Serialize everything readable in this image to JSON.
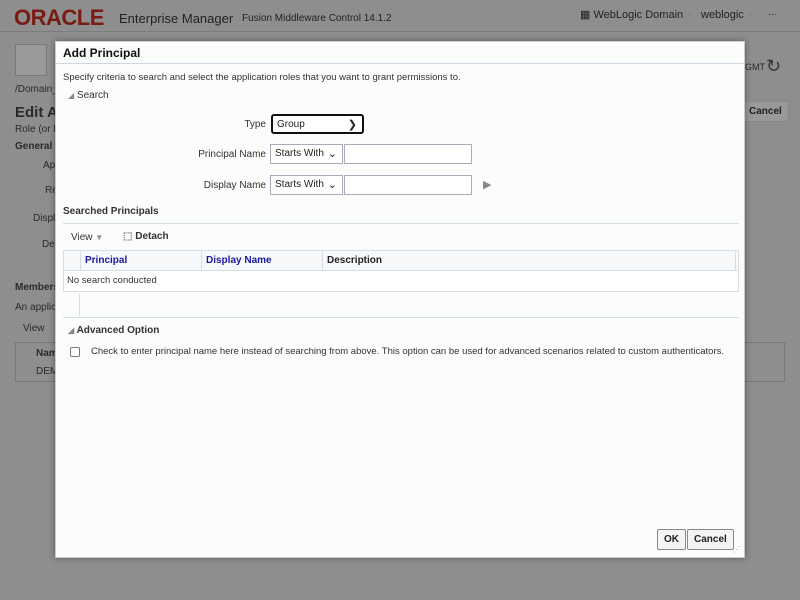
{
  "header": {
    "logo": "ORACLE",
    "product": "Enterprise Manager",
    "subtitle": "Fusion Middleware Control 14.1.2",
    "domain_menu": "WebLogic Domain",
    "user_menu": "weblogic",
    "more": "..."
  },
  "background": {
    "breadcrumb": "/Domain_",
    "title": "Edit A",
    "role": "Role (or E",
    "general": "General",
    "f1": "Ap",
    "f2": "Re",
    "f3": "Displ",
    "f4": "De",
    "members": "Members",
    "applic": "An applic",
    "view": "View",
    "col": "Nam",
    "row": "DEM",
    "gmt": "GMT",
    "cancel": "Cancel"
  },
  "dialog": {
    "title": "Add Principal",
    "instructions": "Specify criteria to search and select the application roles that you want to grant permissions to.",
    "search_section": "Search",
    "type_label": "Type",
    "type_value": "Group",
    "principal_label": "Principal Name",
    "principal_op": "Starts With",
    "principal_value": "",
    "display_label": "Display Name",
    "display_op": "Starts With",
    "display_value": "",
    "searched_title": "Searched Principals",
    "view": "View",
    "detach": "Detach",
    "columns": [
      "Principal",
      "Display Name",
      "Description"
    ],
    "empty": "No search conducted",
    "advanced_section": "Advanced Option",
    "advanced_checkbox": "Check to enter principal name here instead of searching from above. This option can be used for advanced scenarios related to custom authenticators.",
    "ok": "OK",
    "cancel": "Cancel"
  }
}
